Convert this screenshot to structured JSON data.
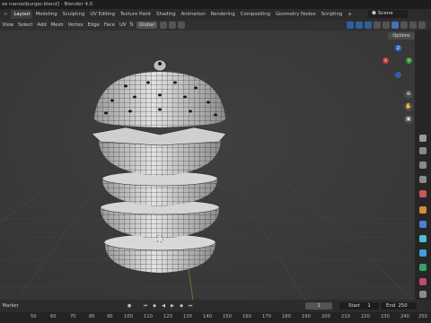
{
  "window": {
    "title": "se nanoo\\burger.blend] - Blender 4.0"
  },
  "workspaces": [
    "Layout",
    "Modeling",
    "Sculpting",
    "UV Editing",
    "Texture Paint",
    "Shading",
    "Animation",
    "Rendering",
    "Compositing",
    "Geometry Nodes",
    "Scripting"
  ],
  "workspace_active": "Layout",
  "scene": {
    "label": "Scene"
  },
  "header": {
    "items": [
      "View",
      "Select",
      "Add",
      "Mesh",
      "Vertex",
      "Edge",
      "Face",
      "UV"
    ],
    "transform": "Global",
    "options": "Options"
  },
  "viewport": {
    "gizmo": {
      "z": "Z",
      "y": "Y",
      "x": "X"
    },
    "bg_color": "#3b3b3b",
    "wire_color": "#1e1e1e",
    "mesh_color": "#d9d9d9"
  },
  "timeline": {
    "marker": "Marker",
    "current_frame": "1",
    "start_label": "Start",
    "start": "1",
    "end_label": "End",
    "end": "250",
    "ruler": [
      "50",
      "60",
      "70",
      "80",
      "90",
      "100",
      "110",
      "120",
      "130",
      "140",
      "150",
      "160",
      "170",
      "180",
      "190",
      "200",
      "210",
      "220",
      "230",
      "240",
      "250"
    ]
  }
}
